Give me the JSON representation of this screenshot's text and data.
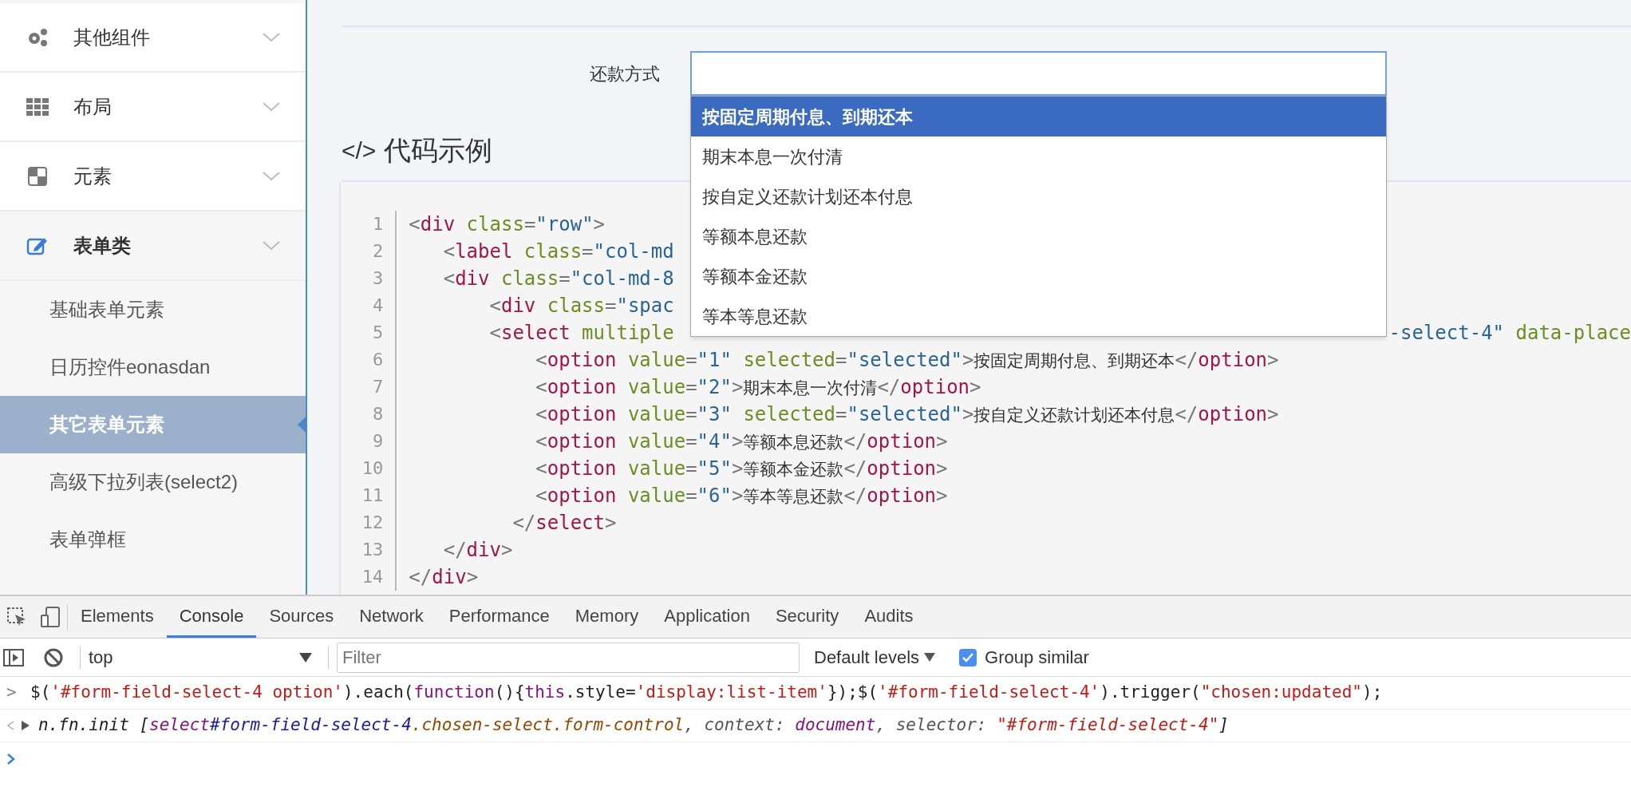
{
  "sidebar": {
    "items": [
      {
        "label": "其他组件",
        "expanded": false
      },
      {
        "label": "布局",
        "expanded": false
      },
      {
        "label": "元素",
        "expanded": false
      },
      {
        "label": "表单类",
        "expanded": true,
        "children": [
          {
            "label": "基础表单元素",
            "selected": false
          },
          {
            "label": "日历控件eonasdan",
            "selected": false
          },
          {
            "label": "其它表单元素",
            "selected": true
          },
          {
            "label": "高级下拉列表(select2)",
            "selected": false
          },
          {
            "label": "表单弹框",
            "selected": false
          }
        ]
      }
    ]
  },
  "form": {
    "label": "还款方式",
    "dropdown": [
      {
        "label": "按固定周期付息、到期还本",
        "selected": true
      },
      {
        "label": "期末本息一次付清",
        "selected": false
      },
      {
        "label": "按自定义还款计划还本付息",
        "selected": false
      },
      {
        "label": "等额本息还款",
        "selected": false
      },
      {
        "label": "等额本金还款",
        "selected": false
      },
      {
        "label": "等本等息还款",
        "selected": false
      }
    ]
  },
  "code_section": {
    "icon_text": "</>",
    "title": "代码示例",
    "lines": [
      {
        "number": "1",
        "tokens": [
          {
            "text": "<",
            "kind": "p"
          },
          {
            "text": "div",
            "kind": "tag"
          },
          {
            "text": " class",
            "kind": "attr"
          },
          {
            "text": "=",
            "kind": "p"
          },
          {
            "text": "\"row\"",
            "kind": "str"
          },
          {
            "text": ">",
            "kind": "p"
          }
        ]
      },
      {
        "number": "2",
        "tokens": [
          {
            "text": "   <",
            "kind": "p"
          },
          {
            "text": "label",
            "kind": "tag"
          },
          {
            "text": " class",
            "kind": "attr"
          },
          {
            "text": "=",
            "kind": "p"
          },
          {
            "text": "\"col-md",
            "kind": "str"
          }
        ]
      },
      {
        "number": "3",
        "tokens": [
          {
            "text": "   <",
            "kind": "p"
          },
          {
            "text": "div",
            "kind": "tag"
          },
          {
            "text": " class",
            "kind": "attr"
          },
          {
            "text": "=",
            "kind": "p"
          },
          {
            "text": "\"col-md-8",
            "kind": "str"
          }
        ]
      },
      {
        "number": "4",
        "tokens": [
          {
            "text": "       <",
            "kind": "p"
          },
          {
            "text": "div",
            "kind": "tag"
          },
          {
            "text": " class",
            "kind": "attr"
          },
          {
            "text": "=",
            "kind": "p"
          },
          {
            "text": "\"spac",
            "kind": "str"
          }
        ]
      },
      {
        "number": "5",
        "tokens": [
          {
            "text": "       <",
            "kind": "p"
          },
          {
            "text": "select",
            "kind": "tag"
          },
          {
            "text": " multiple",
            "kind": "attr"
          }
        ],
        "tokens_after": [
          {
            "text": "-select-4\"",
            "kind": "str"
          },
          {
            "text": " data-place",
            "kind": "attr"
          }
        ]
      },
      {
        "number": "6",
        "tokens": [
          {
            "text": "           <",
            "kind": "p"
          },
          {
            "text": "option",
            "kind": "tag"
          },
          {
            "text": " value",
            "kind": "attr"
          },
          {
            "text": "=",
            "kind": "p"
          },
          {
            "text": "\"1\"",
            "kind": "str"
          },
          {
            "text": " selected",
            "kind": "attr"
          },
          {
            "text": "=",
            "kind": "p"
          },
          {
            "text": "\"selected\"",
            "kind": "str"
          },
          {
            "text": ">",
            "kind": "p"
          },
          {
            "text": "按固定周期付息、到期还本",
            "kind": "text"
          },
          {
            "text": "</",
            "kind": "p"
          },
          {
            "text": "option",
            "kind": "tag"
          },
          {
            "text": ">",
            "kind": "p"
          }
        ]
      },
      {
        "number": "7",
        "tokens": [
          {
            "text": "           <",
            "kind": "p"
          },
          {
            "text": "option",
            "kind": "tag"
          },
          {
            "text": " value",
            "kind": "attr"
          },
          {
            "text": "=",
            "kind": "p"
          },
          {
            "text": "\"2\"",
            "kind": "str"
          },
          {
            "text": ">",
            "kind": "p"
          },
          {
            "text": "期末本息一次付清",
            "kind": "text"
          },
          {
            "text": "</",
            "kind": "p"
          },
          {
            "text": "option",
            "kind": "tag"
          },
          {
            "text": ">",
            "kind": "p"
          }
        ]
      },
      {
        "number": "8",
        "tokens": [
          {
            "text": "           <",
            "kind": "p"
          },
          {
            "text": "option",
            "kind": "tag"
          },
          {
            "text": " value",
            "kind": "attr"
          },
          {
            "text": "=",
            "kind": "p"
          },
          {
            "text": "\"3\"",
            "kind": "str"
          },
          {
            "text": " selected",
            "kind": "attr"
          },
          {
            "text": "=",
            "kind": "p"
          },
          {
            "text": "\"selected\"",
            "kind": "str"
          },
          {
            "text": ">",
            "kind": "p"
          },
          {
            "text": "按自定义还款计划还本付息",
            "kind": "text"
          },
          {
            "text": "</",
            "kind": "p"
          },
          {
            "text": "option",
            "kind": "tag"
          },
          {
            "text": ">",
            "kind": "p"
          }
        ]
      },
      {
        "number": "9",
        "tokens": [
          {
            "text": "           <",
            "kind": "p"
          },
          {
            "text": "option",
            "kind": "tag"
          },
          {
            "text": " value",
            "kind": "attr"
          },
          {
            "text": "=",
            "kind": "p"
          },
          {
            "text": "\"4\"",
            "kind": "str"
          },
          {
            "text": ">",
            "kind": "p"
          },
          {
            "text": "等额本息还款",
            "kind": "text"
          },
          {
            "text": "</",
            "kind": "p"
          },
          {
            "text": "option",
            "kind": "tag"
          },
          {
            "text": ">",
            "kind": "p"
          }
        ]
      },
      {
        "number": "10",
        "tokens": [
          {
            "text": "           <",
            "kind": "p"
          },
          {
            "text": "option",
            "kind": "tag"
          },
          {
            "text": " value",
            "kind": "attr"
          },
          {
            "text": "=",
            "kind": "p"
          },
          {
            "text": "\"5\"",
            "kind": "str"
          },
          {
            "text": ">",
            "kind": "p"
          },
          {
            "text": "等额本金还款",
            "kind": "text"
          },
          {
            "text": "</",
            "kind": "p"
          },
          {
            "text": "option",
            "kind": "tag"
          },
          {
            "text": ">",
            "kind": "p"
          }
        ]
      },
      {
        "number": "11",
        "tokens": [
          {
            "text": "           <",
            "kind": "p"
          },
          {
            "text": "option",
            "kind": "tag"
          },
          {
            "text": " value",
            "kind": "attr"
          },
          {
            "text": "=",
            "kind": "p"
          },
          {
            "text": "\"6\"",
            "kind": "str"
          },
          {
            "text": ">",
            "kind": "p"
          },
          {
            "text": "等本等息还款",
            "kind": "text"
          },
          {
            "text": "</",
            "kind": "p"
          },
          {
            "text": "option",
            "kind": "tag"
          },
          {
            "text": ">",
            "kind": "p"
          }
        ]
      },
      {
        "number": "12",
        "tokens": [
          {
            "text": "         </",
            "kind": "p"
          },
          {
            "text": "select",
            "kind": "tag"
          },
          {
            "text": ">",
            "kind": "p"
          }
        ]
      },
      {
        "number": "13",
        "tokens": [
          {
            "text": "   </",
            "kind": "p"
          },
          {
            "text": "div",
            "kind": "tag"
          },
          {
            "text": ">",
            "kind": "p"
          }
        ]
      },
      {
        "number": "14",
        "tokens": [
          {
            "text": "</",
            "kind": "p"
          },
          {
            "text": "div",
            "kind": "tag"
          },
          {
            "text": ">",
            "kind": "p"
          }
        ]
      }
    ]
  },
  "devtools": {
    "tabs": [
      {
        "label": "Elements",
        "selected": false
      },
      {
        "label": "Console",
        "selected": true
      },
      {
        "label": "Sources",
        "selected": false
      },
      {
        "label": "Network",
        "selected": false
      },
      {
        "label": "Performance",
        "selected": false
      },
      {
        "label": "Memory",
        "selected": false
      },
      {
        "label": "Application",
        "selected": false
      },
      {
        "label": "Security",
        "selected": false
      },
      {
        "label": "Audits",
        "selected": false
      }
    ],
    "context": "top",
    "filter_placeholder": "Filter",
    "levels": "Default levels",
    "group_similar": {
      "label": "Group similar",
      "checked": true
    },
    "console": [
      {
        "kind": "input",
        "marker": ">",
        "tokens": [
          {
            "text": "$(",
            "kind": "dark"
          },
          {
            "text": "'#form-field-select-4 option'",
            "kind": "red"
          },
          {
            "text": ").each(",
            "kind": "dark"
          },
          {
            "text": "function",
            "kind": "purple"
          },
          {
            "text": "(){",
            "kind": "dark"
          },
          {
            "text": "this",
            "kind": "purple"
          },
          {
            "text": ".style=",
            "kind": "dark"
          },
          {
            "text": "'display:list-item'",
            "kind": "red"
          },
          {
            "text": "});$(",
            "kind": "dark"
          },
          {
            "text": "'#form-field-select-4'",
            "kind": "red"
          },
          {
            "text": ").trigger(",
            "kind": "dark"
          },
          {
            "text": "\"chosen:updated\"",
            "kind": "red"
          },
          {
            "text": ");",
            "kind": "dark"
          }
        ]
      },
      {
        "kind": "result",
        "tokens": [
          {
            "text": "n.fn.init [",
            "kind": "dark"
          },
          {
            "text": "select",
            "kind": "purple"
          },
          {
            "text": "#form-field-select-4",
            "kind": "blue"
          },
          {
            "text": ".chosen-select.form-control",
            "kind": "brown"
          },
          {
            "text": ", context: ",
            "kind": "gray"
          },
          {
            "text": "document",
            "kind": "purple"
          },
          {
            "text": ", selector: ",
            "kind": "gray"
          },
          {
            "text": "\"#form-field-select-4\"",
            "kind": "red"
          },
          {
            "text": "]",
            "kind": "dark"
          }
        ]
      },
      {
        "kind": "prompt"
      }
    ]
  }
}
